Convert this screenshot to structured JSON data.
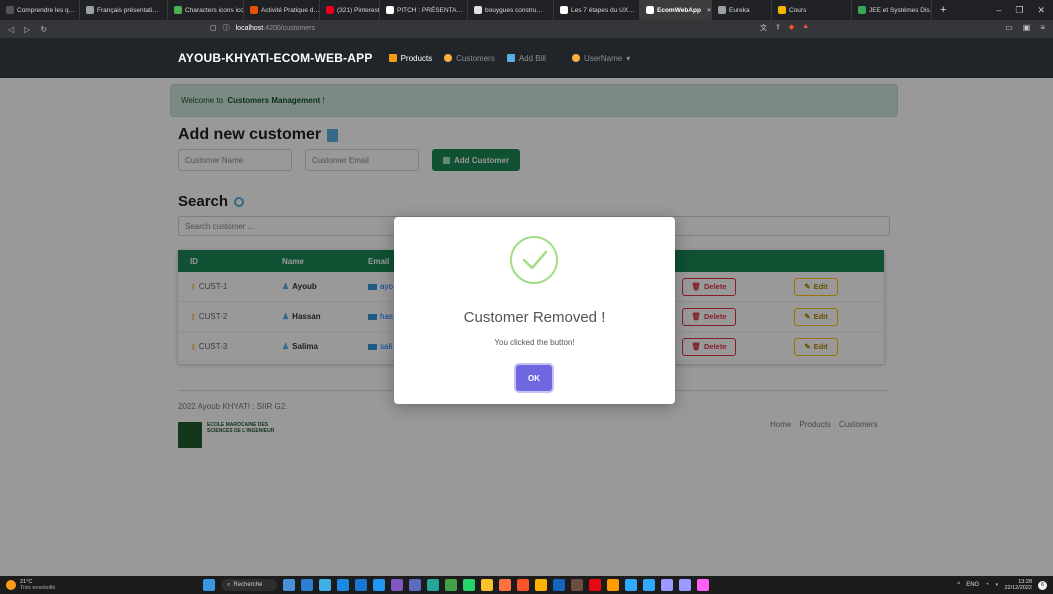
{
  "browser": {
    "tabs": [
      {
        "label": "Comprendre les q…",
        "color": "#555"
      },
      {
        "label": "Français présentati…",
        "color": "#9aa0a6"
      },
      {
        "label": "Characters icons ico…",
        "color": "#4caf50"
      },
      {
        "label": "Activité Pratique d…",
        "color": "#e65100"
      },
      {
        "label": "(321) Pinterest",
        "color": "#e60023"
      },
      {
        "label": "PITCH : PRÉSENTA…",
        "color": "#ffffff"
      },
      {
        "label": "bouygues constru…",
        "color": "#e0e0e0"
      },
      {
        "label": "Les 7 étapes du UX…",
        "color": "#ffffff"
      },
      {
        "label": "EcomWebApp",
        "color": "#ffffff",
        "active": true
      },
      {
        "label": "Eureka",
        "color": "#9aa0a6"
      },
      {
        "label": "Cours",
        "color": "#f4b400"
      },
      {
        "label": "JEE et Systèmes Dis…",
        "color": "#34a853"
      }
    ],
    "close_tab": "×",
    "new_tab": "+",
    "url_host": "localhost",
    "url_path": ":4200/customers"
  },
  "nav": {
    "brand": "AYOUB-KHYATI-ECOM-WEB-APP",
    "links": [
      {
        "label": "Products",
        "active": true,
        "icon_color": "#f39c12"
      },
      {
        "label": "Customers",
        "active": false,
        "icon_color": "#f5b041"
      },
      {
        "label": "Add Bill",
        "active": false,
        "icon_color": "#5dade2"
      },
      {
        "label": "UserName",
        "active": false,
        "icon_color": "#f5b041",
        "caret": "▾"
      }
    ]
  },
  "alert": {
    "prefix": "Welcome to",
    "strong": "Customers Management",
    "suffix": "!"
  },
  "add_form": {
    "title": "Add new customer",
    "name_placeholder": "Customer Name",
    "email_placeholder": "Customer Email",
    "button_label": "Add Customer"
  },
  "search": {
    "title": "Search",
    "placeholder": "Search customer ..."
  },
  "table": {
    "headers": [
      "ID",
      "Name",
      "Email"
    ],
    "rows": [
      {
        "id": "CUST-1",
        "name": "Ayoub",
        "email": "ayo"
      },
      {
        "id": "CUST-2",
        "name": "Hassan",
        "email": "has"
      },
      {
        "id": "CUST-3",
        "name": "Salima",
        "email": "sali"
      }
    ],
    "delete_label": "Delete",
    "edit_label": "Edit"
  },
  "footer": {
    "copyright": "2022 Ayoub KHYATI : SIIR G2.",
    "school": "ECOLE MAROCAINE DES SCIENCES DE L'INGENIEUR",
    "links": [
      "Home",
      "Products",
      "Customers"
    ]
  },
  "modal": {
    "title": "Customer Removed !",
    "text": "You clicked the button!",
    "ok_label": "OK"
  },
  "taskbar": {
    "temperature": "21°C",
    "weather": "Très ensoleillé",
    "search_label": "Recherche",
    "lang": "ENG",
    "time": "13:28",
    "date": "22/12/2022",
    "notifications": "6"
  }
}
